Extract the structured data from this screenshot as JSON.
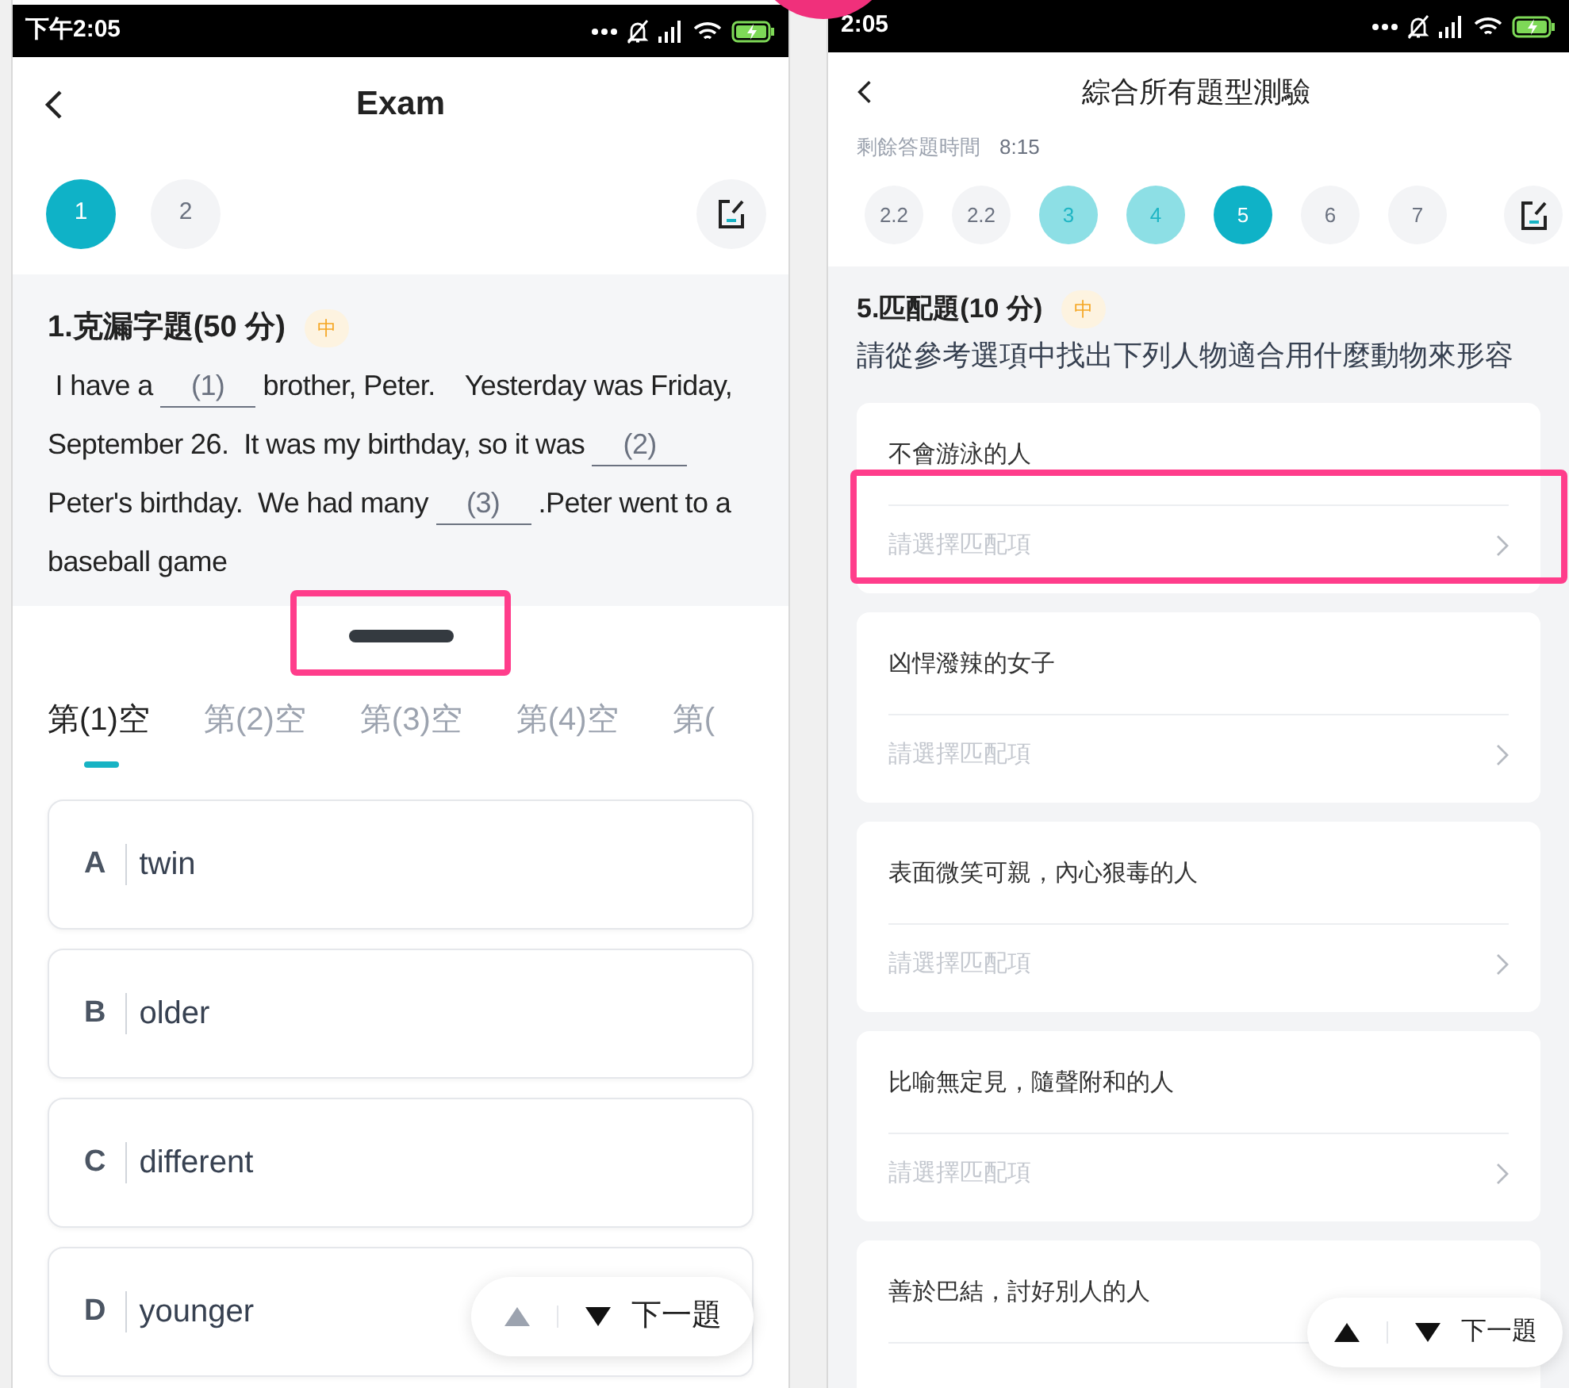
{
  "left": {
    "status_bar": {
      "time": "下午2:05"
    },
    "header": {
      "title": "Exam"
    },
    "question_nav": [
      {
        "label": "1",
        "kind": "current"
      },
      {
        "label": "2",
        "kind": "unanswered"
      }
    ],
    "question": {
      "title": "1.克漏字題(50 分)",
      "difficulty": "中",
      "passage": [
        {
          "kind": "text",
          "text": " I have a "
        },
        {
          "kind": "blank",
          "text": "(1)"
        },
        {
          "kind": "text",
          "text": " brother, Peter.    Yesterday was Friday, September 26.  It was my birthday, so it was "
        },
        {
          "kind": "blank",
          "text": "(2)"
        },
        {
          "kind": "text",
          "text": " Peter's birthday.  We had many "
        },
        {
          "kind": "blank",
          "text": "(3)"
        },
        {
          "kind": "text",
          "text": " .Peter went to a baseball game"
        }
      ]
    },
    "blank_tabs": [
      {
        "label": "第(1)空",
        "selected": true
      },
      {
        "label": "第(2)空",
        "selected": false
      },
      {
        "label": "第(3)空",
        "selected": false
      },
      {
        "label": "第(4)空",
        "selected": false
      },
      {
        "label": "第(",
        "selected": false
      }
    ],
    "options": [
      {
        "letter": "A",
        "text": "twin"
      },
      {
        "letter": "B",
        "text": "older"
      },
      {
        "letter": "C",
        "text": "different"
      },
      {
        "letter": "D",
        "text": "younger"
      }
    ],
    "pager": {
      "next_label": "下一題",
      "up_disabled": true
    }
  },
  "right": {
    "status_bar": {
      "time": "2:05"
    },
    "header": {
      "title": "綜合所有題型測驗"
    },
    "timer": {
      "label": "剩餘答題時間",
      "value": "8:15"
    },
    "question_nav": [
      {
        "label": "2.2",
        "kind": "unanswered"
      },
      {
        "label": "2.2",
        "kind": "unanswered"
      },
      {
        "label": "3",
        "kind": "answered"
      },
      {
        "label": "4",
        "kind": "answered"
      },
      {
        "label": "5",
        "kind": "current"
      },
      {
        "label": "6",
        "kind": "unanswered"
      },
      {
        "label": "7",
        "kind": "unanswered"
      }
    ],
    "question": {
      "title": "5.匹配題(10 分)",
      "difficulty": "中",
      "instruction": "請從參考選項中找出下列人物適合用什麼動物來形容"
    },
    "items": [
      {
        "prompt": "不會游泳的人",
        "placeholder": "請選擇匹配項"
      },
      {
        "prompt": "凶悍潑辣的女子",
        "placeholder": "請選擇匹配項"
      },
      {
        "prompt": "表面微笑可親，內心狠毒的人",
        "placeholder": "請選擇匹配項"
      },
      {
        "prompt": "比喻無定見，隨聲附和的人",
        "placeholder": "請選擇匹配項"
      },
      {
        "prompt": "善於巴結，討好別人的人"
      }
    ],
    "pager": {
      "next_label": "下一題",
      "up_disabled": false
    }
  }
}
